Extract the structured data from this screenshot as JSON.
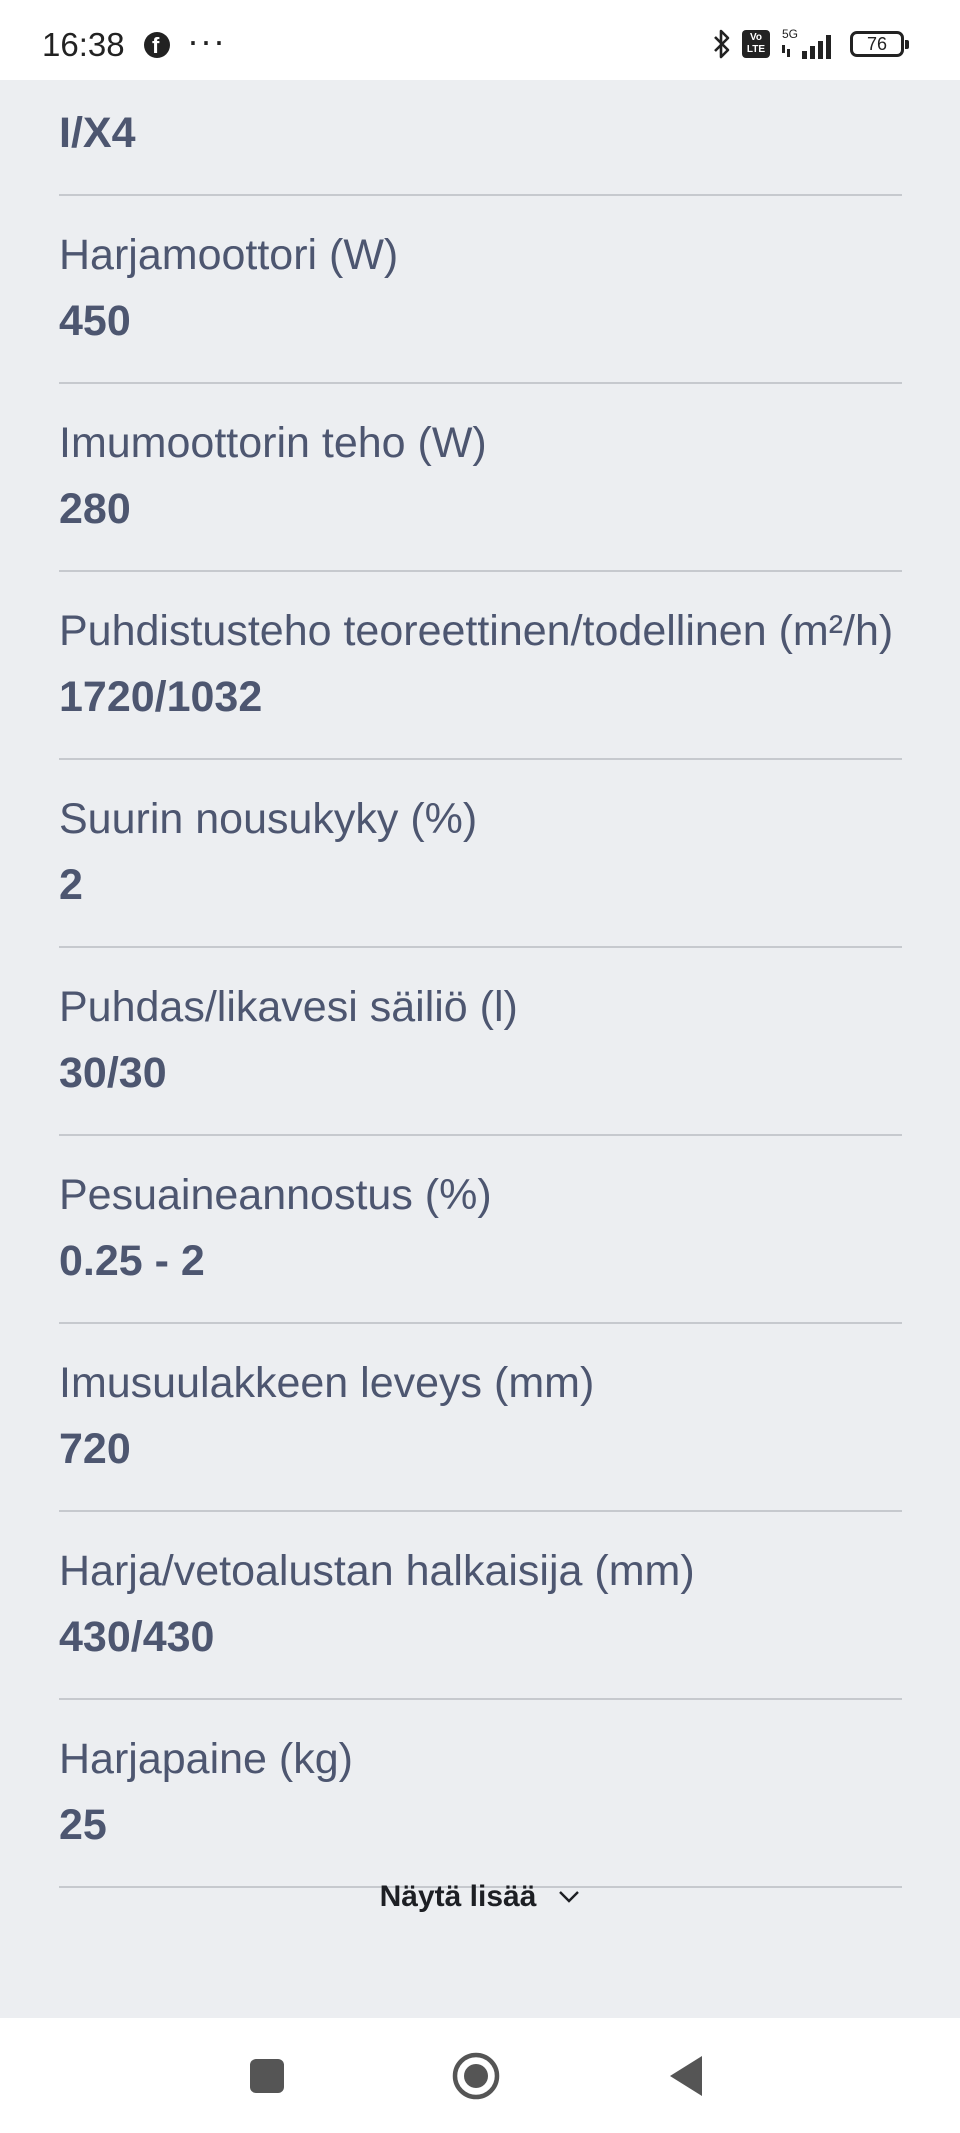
{
  "status_bar": {
    "time": "16:38",
    "notification_icons": [
      "facebook-icon",
      "more-dots-icon"
    ],
    "system_icons": [
      "bluetooth-icon",
      "volte-icon",
      "5g-signal-icon"
    ],
    "network_label": "5G",
    "volte_label": "Vo LTE",
    "battery": "76"
  },
  "specs": [
    {
      "label": "",
      "value": "I/X4"
    },
    {
      "label": "Harjamoottori (W)",
      "value": "450"
    },
    {
      "label": "Imumoottorin teho (W)",
      "value": "280"
    },
    {
      "label": "Puhdistusteho teoreettinen/todellinen (m²/h)",
      "value": "1720/1032"
    },
    {
      "label": "Suurin nousukyky (%)",
      "value": "2"
    },
    {
      "label": "Puhdas/likavesi säiliö (l)",
      "value": "30/30"
    },
    {
      "label": "Pesuaineannostus (%)",
      "value": "0.25 - 2"
    },
    {
      "label": "Imusuulakkeen leveys (mm)",
      "value": "720"
    },
    {
      "label": "Harja/vetoalustan halkaisija (mm)",
      "value": "430/430"
    },
    {
      "label": "Harjapaine (kg)",
      "value": "25"
    }
  ],
  "show_more": {
    "label": "Näytä lisää",
    "icon": "chevron-down-icon"
  },
  "nav_bar": {
    "buttons": [
      "recent-apps-icon",
      "home-icon",
      "back-icon"
    ]
  },
  "colors": {
    "text": "#4d5670",
    "background": "#eceef1",
    "divider": "#c6c9ce"
  }
}
